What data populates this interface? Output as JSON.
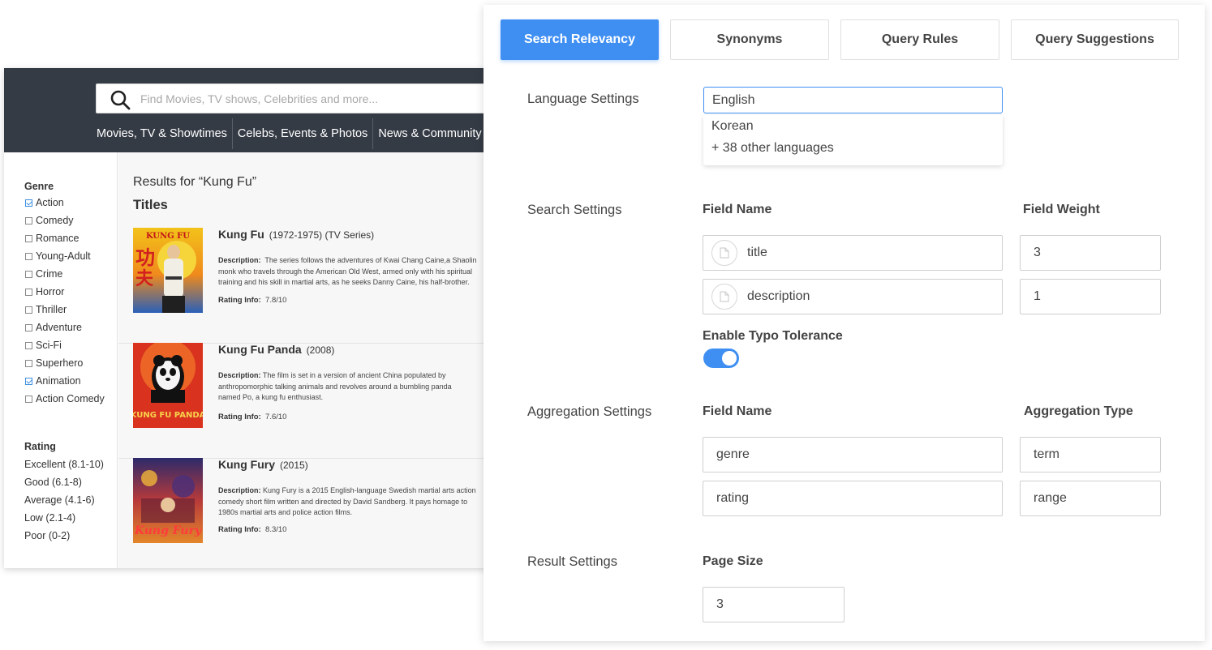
{
  "search_page": {
    "search": {
      "placeholder": "Find Movies, TV shows, Celebrities and more..."
    },
    "nav": [
      "Movies, TV & Showtimes",
      "Celebs, Events & Photos",
      "News & Community"
    ],
    "genre": {
      "title": "Genre",
      "items": [
        {
          "label": "Action",
          "checked": true
        },
        {
          "label": "Comedy",
          "checked": false
        },
        {
          "label": "Romance",
          "checked": false
        },
        {
          "label": "Young-Adult",
          "checked": false
        },
        {
          "label": "Crime",
          "checked": false
        },
        {
          "label": "Horror",
          "checked": false
        },
        {
          "label": "Thriller",
          "checked": false
        },
        {
          "label": "Adventure",
          "checked": false
        },
        {
          "label": "Sci-Fi",
          "checked": false
        },
        {
          "label": "Superhero",
          "checked": false
        },
        {
          "label": "Animation",
          "checked": true
        },
        {
          "label": "Action Comedy",
          "checked": false
        }
      ]
    },
    "rating": {
      "title": "Rating",
      "items": [
        "Excellent (8.1-10)",
        "Good (6.1-8)",
        "Average (4.1-6)",
        "Low (2.1-4)",
        "Poor (0-2)"
      ]
    },
    "results_heading": "Results for “Kung Fu”",
    "titles_heading": "Titles",
    "results": [
      {
        "title": "Kung Fu",
        "meta": "(1972-1975)  (TV Series)",
        "desc_label": "Description:",
        "description": "The series follows the adventures of Kwai Chang Caine,a Shaolin monk who travels through the American Old West, armed only with his spiritual training and his skill in martial arts, as he seeks Danny Caine, his half-brother.",
        "rating_label": "Rating Info:",
        "rating": "7.8/10",
        "poster_text": "KUNG FU"
      },
      {
        "title": "Kung Fu Panda",
        "meta": "(2008)",
        "desc_label": "Description:",
        "description": "The film is set in a version of ancient China populated by anthropomorphic talking animals and revolves around a bumbling panda named Po, a kung fu enthusiast.",
        "rating_label": "Rating Info:",
        "rating": "7.6/10",
        "poster_text": "KUNG FU PANDA"
      },
      {
        "title": "Kung Fury",
        "meta": "(2015)",
        "desc_label": "Description:",
        "description": "Kung Fury is a 2015 English-language Swedish martial arts action comedy short film written and directed by David Sandberg. It pays homage to 1980s martial arts and police action films.",
        "rating_label": "Rating Info:",
        "rating": "8.3/10",
        "poster_text": "Kung Fury"
      }
    ]
  },
  "panel": {
    "tabs": [
      {
        "label": "Search Relevancy",
        "active": true
      },
      {
        "label": "Synonyms",
        "active": false
      },
      {
        "label": "Query Rules",
        "active": false
      },
      {
        "label": "Query Suggestions",
        "active": false
      }
    ],
    "language": {
      "label": "Language Settings",
      "selected": "English",
      "options": [
        "Korean",
        "+ 38 other languages"
      ]
    },
    "search_settings": {
      "label": "Search Settings",
      "field_name_header": "Field Name",
      "field_weight_header": "Field Weight",
      "fields": [
        {
          "name": "title",
          "weight": "3"
        },
        {
          "name": "description",
          "weight": "1"
        }
      ],
      "typo_label": "Enable Typo Tolerance",
      "typo_enabled": true
    },
    "aggregation_settings": {
      "label": "Aggregation Settings",
      "field_name_header": "Field Name",
      "type_header": "Aggregation Type",
      "fields": [
        {
          "name": "genre",
          "type": "term"
        },
        {
          "name": "rating",
          "type": "range"
        }
      ]
    },
    "result_settings": {
      "label": "Result Settings",
      "page_size_header": "Page Size",
      "page_size": "3"
    },
    "colors": {
      "accent": "#3f8ff3",
      "topbar": "#353b45"
    }
  }
}
